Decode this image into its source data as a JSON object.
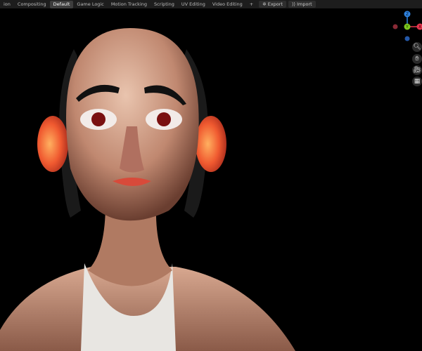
{
  "workspace_tabs": [
    {
      "label": "ion",
      "active": false
    },
    {
      "label": "Compositing",
      "active": false
    },
    {
      "label": "Default",
      "active": true
    },
    {
      "label": "Game Logic",
      "active": false
    },
    {
      "label": "Motion Tracking",
      "active": false
    },
    {
      "label": "Scripting",
      "active": false
    },
    {
      "label": "UV Editing",
      "active": false
    },
    {
      "label": "Video Editing",
      "active": false
    }
  ],
  "add_tab_label": "+",
  "export_label": "Export",
  "import_label": "Import",
  "gizmo": {
    "z": "Z",
    "y": "Y",
    "x": "X",
    "colors": {
      "x": "#e8364f",
      "y": "#7ec81e",
      "z": "#2f83e0"
    }
  },
  "nav": {
    "zoom": "zoom-icon",
    "pan": "hand-icon",
    "camera": "camera-icon",
    "grid": "grid-icon"
  }
}
